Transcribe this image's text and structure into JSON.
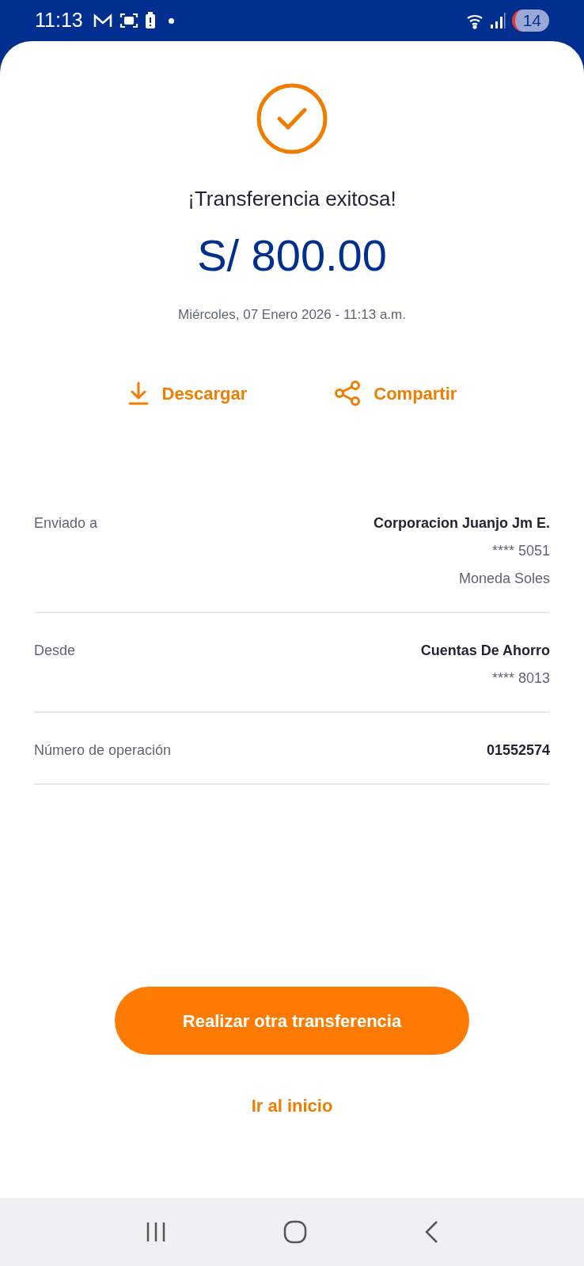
{
  "status_bar": {
    "time": "11:13",
    "notification_count": "14"
  },
  "result": {
    "title": "¡Transferencia exitosa!",
    "amount": "S/ 800.00",
    "date": "Miércoles, 07 Enero 2026 - 11:13 a.m."
  },
  "actions": [
    {
      "kind": "download",
      "label": "Descargar"
    },
    {
      "kind": "share",
      "label": "Compartir"
    }
  ],
  "details": [
    {
      "label": "Enviado a",
      "values": [
        "Corporacion Juanjo Jm E.",
        "**** 5051",
        "Moneda Soles"
      ]
    },
    {
      "label": "Desde",
      "values": [
        "Cuentas De Ahorro",
        "**** 8013"
      ]
    },
    {
      "label": "Número de operación",
      "values": [
        "01552574"
      ]
    }
  ],
  "primary_button": "Realizar otra transferencia",
  "secondary_link": "Ir al inicio"
}
